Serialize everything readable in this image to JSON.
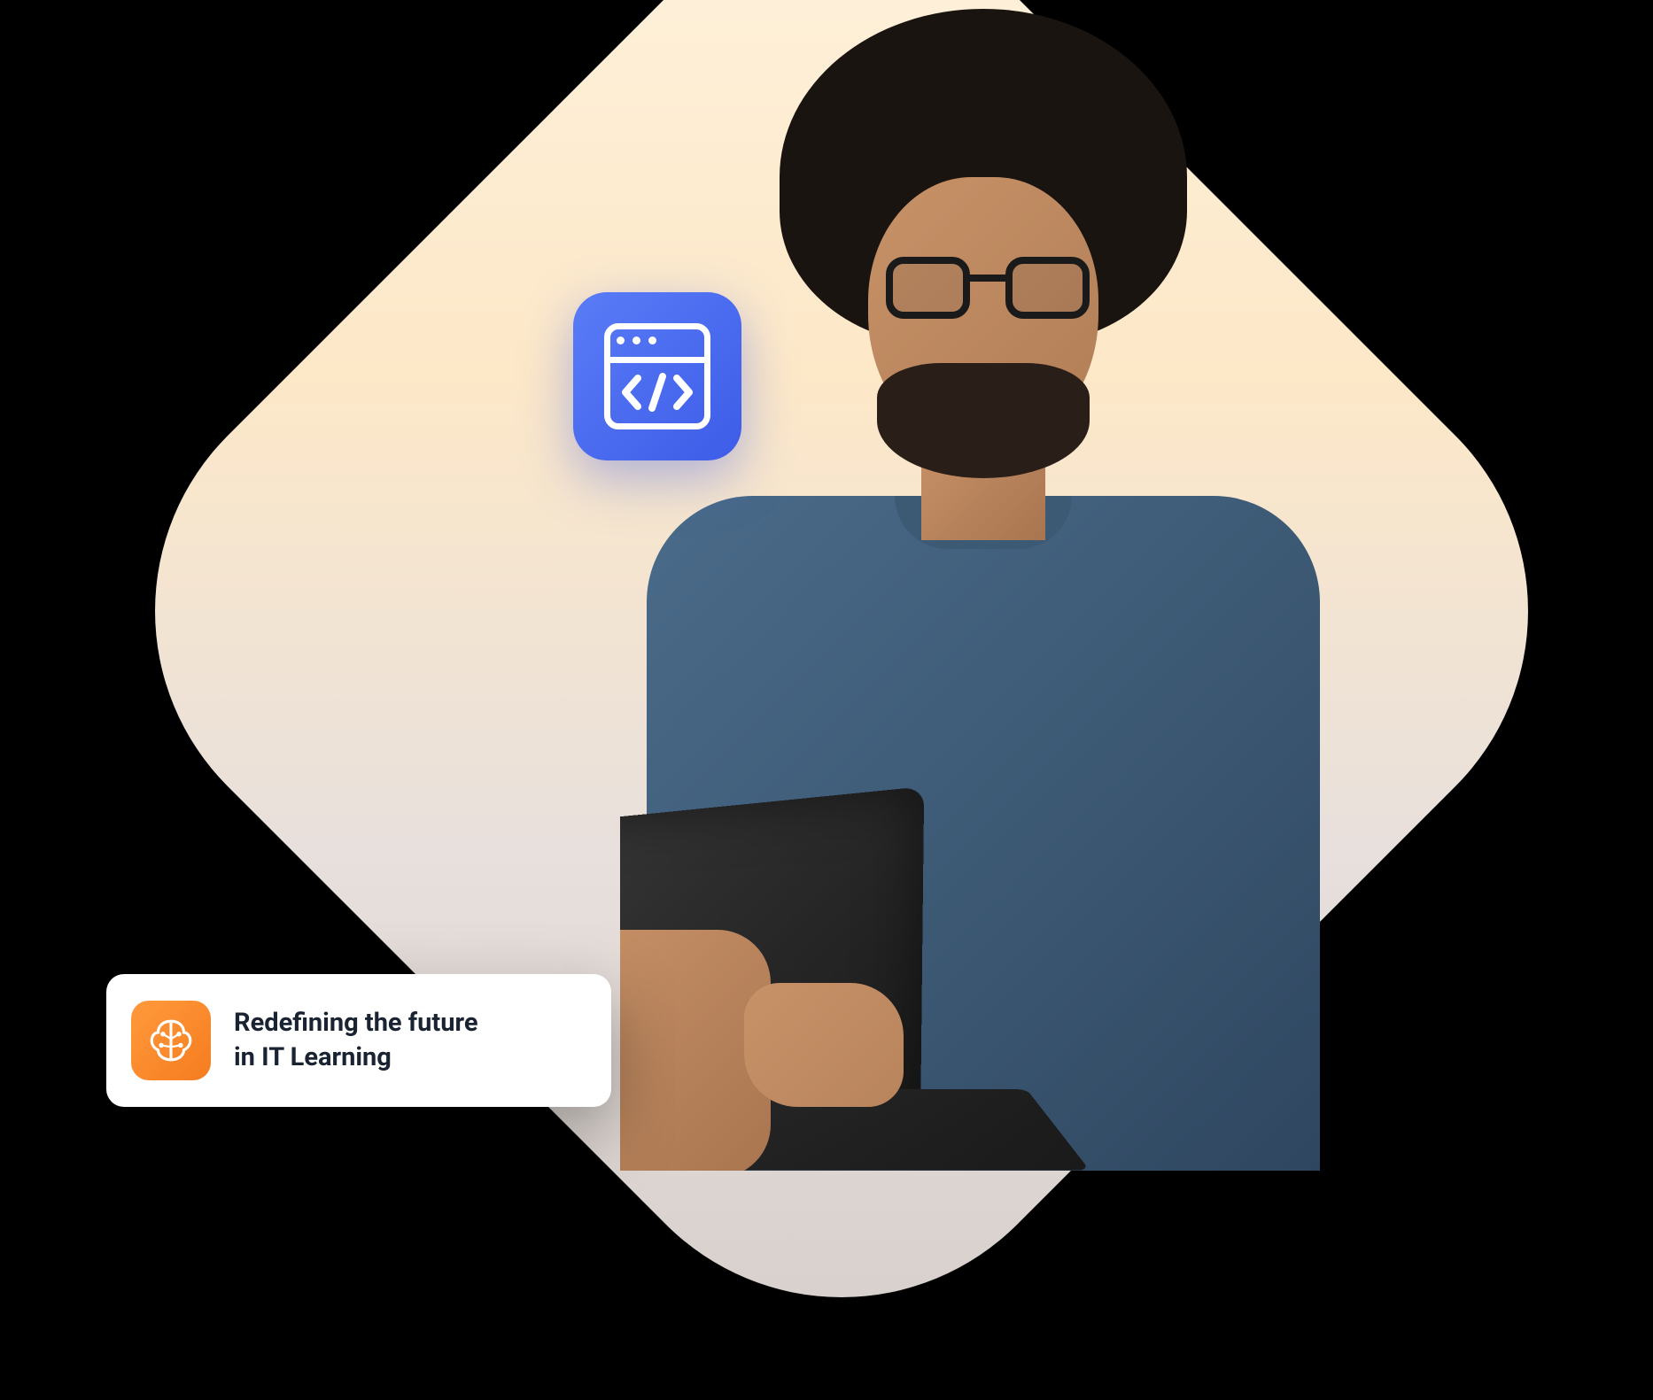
{
  "badges": {
    "code": {
      "icon_name": "code-browser-icon",
      "color": "#3d5ce8"
    },
    "brain": {
      "icon_name": "brain-ai-icon",
      "color": "#f57c1f"
    }
  },
  "tagline": {
    "line1": "Redefining the future",
    "line2": "in IT Learning"
  }
}
